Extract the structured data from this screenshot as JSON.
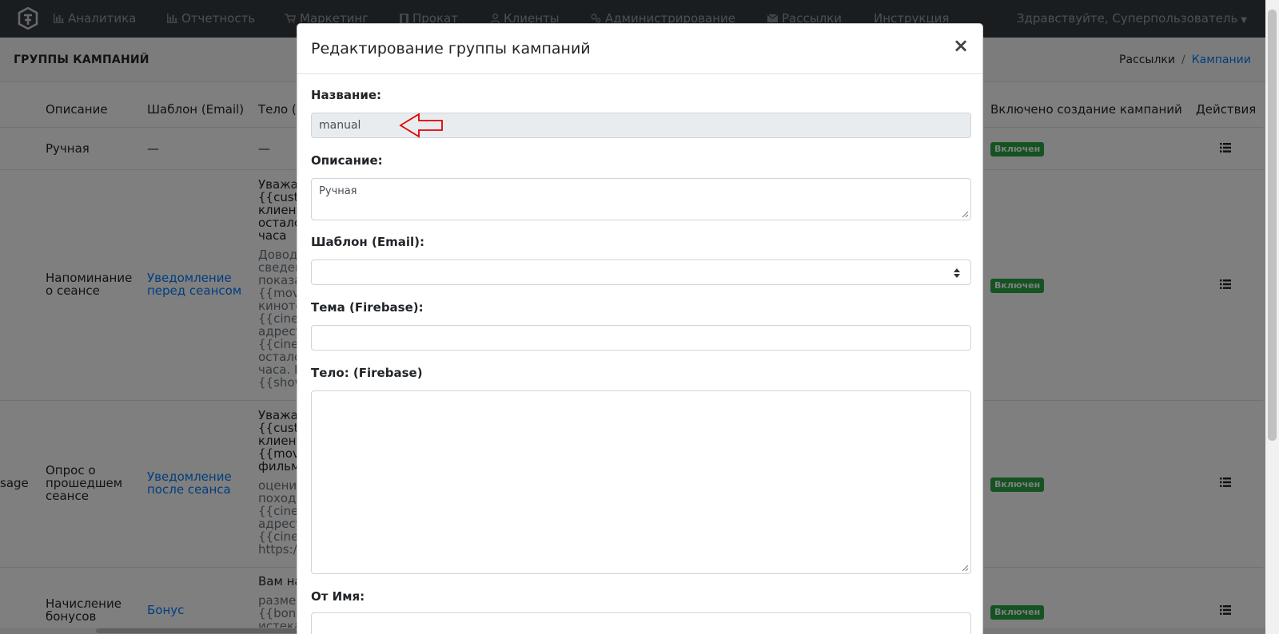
{
  "nav": {
    "items": [
      {
        "label": "Аналитика",
        "icon": "bar-chart-icon"
      },
      {
        "label": "Отчетность",
        "icon": "bar-chart-icon"
      },
      {
        "label": "Маркетинг",
        "icon": "cart-icon"
      },
      {
        "label": "Прокат",
        "icon": "film-icon"
      },
      {
        "label": "Клиенты",
        "icon": "user-icon"
      },
      {
        "label": "Администрирование",
        "icon": "cogs-icon"
      },
      {
        "label": "Рассылки",
        "icon": "envelope-icon"
      },
      {
        "label": "Инструкция",
        "icon": ""
      }
    ],
    "greeting": "Здравствуйте, Суперпользователь"
  },
  "page": {
    "title": "ГРУППЫ КАМПАНИЙ",
    "breadcrumb": [
      "Рассылки",
      "Кампании"
    ]
  },
  "table": {
    "headers": {
      "description": "Описание",
      "template": "Шаблон (Email)",
      "body": "Тело (",
      "enabled": "Включено создание кампаний",
      "actions": "Действия"
    },
    "rows": [
      {
        "left_fragment": "",
        "description": "Ручная",
        "template": "—",
        "body_main": "—",
        "body_muted": "",
        "status": "Включен"
      },
      {
        "left_fragment": "",
        "description": "Напоминание\nо сеансе",
        "template": "Уведомление\nперед сеансом",
        "body_main": "Уважа\n{{custo\nклиент\nостало\nчаса",
        "body_muted": "Довод\nсведен\nпоказа\n{{movi\nкиното\n{{ciner\nадресу\n{{ciner\nостало\nчаса. В\n{{show",
        "status": "Включен"
      },
      {
        "left_fragment": "sage",
        "description": "Опрос о\nпрошедшем\nсеансе",
        "template": "Уведомление\nпосле сеанса",
        "body_main": "Уважа\n{{custo\nклиент\n{{movi\nфильм",
        "body_muted": "оцени\nпоходе\n{{ciner\nадресу\n{{ciner\nhttps:/",
        "status": "Включен"
      },
      {
        "left_fragment": "",
        "description": "Начисление\nбонусов",
        "template": "Бонус",
        "body_main": "Вам на",
        "body_muted": "разме\n{{bonu\nистека",
        "status": "Включен"
      }
    ]
  },
  "modal": {
    "title": "Редактирование группы кампаний",
    "close_symbol": "×",
    "fields": {
      "name_label": "Название:",
      "name_value": "manual",
      "description_label": "Описание:",
      "description_value": "Ручная",
      "template_label": "Шаблон (Email):",
      "template_value": "",
      "topic_label": "Тема (Firebase):",
      "topic_value": "",
      "body_label": "Тело: (Firebase)",
      "body_value": "",
      "from_label": "От Имя:",
      "from_value": ""
    }
  },
  "colors": {
    "navbar": "#343a40",
    "link": "#007bff",
    "badge": "#28a745",
    "annotation_arrow": "#e00000"
  }
}
